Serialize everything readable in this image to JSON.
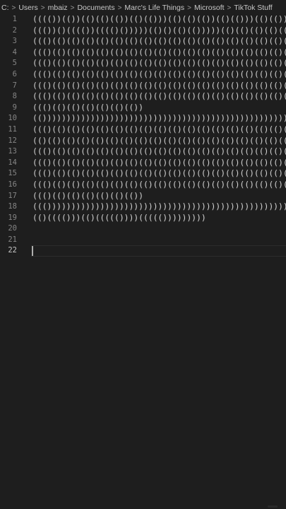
{
  "breadcrumb": [
    "C:",
    "Users",
    "mbaiz",
    "Documents",
    "Marc's Life Things",
    "Microsoft",
    "TikTok Stuff"
  ],
  "breadcrumb_separator": ">",
  "editor": {
    "active_line": 22,
    "lines": [
      {
        "number": "1",
        "text": "(((())(())(()(()(())(()(()))(()(()(())(()(()))(()(()))(((()))(()"
      },
      {
        "number": "2",
        "text": "((())()(((())(((()()))))(()()(()(()))))(()(()(()(()(()(()))(())"
      },
      {
        "number": "3",
        "text": "((()(()(()(()(()(()(()(()(()(()(()(()(()(()(()(()(()(()(()(()(()"
      },
      {
        "number": "4",
        "text": "((()(()(()(()(()(()(()(()(()(()(()(()(()(()(()(()(()(()(()(()(()"
      },
      {
        "number": "5",
        "text": "((()(()(()(()(()(()(()(()(()(()(()(()(()(()(()(()(()(()(()(()(()"
      },
      {
        "number": "6",
        "text": "((()(()(()(()(()(()(()(()(()(()(()(()(()(()(()(()(()(()(()(()(()"
      },
      {
        "number": "7",
        "text": "((()(()(()(()(()(()(()(()(()(()(()(()(()(()(()(()(()(()(()(()(()"
      },
      {
        "number": "8",
        "text": "((()(()(()(()(()(()(()(()(()(()(()(()(()(()(()(()(()(()(()(()(()"
      },
      {
        "number": "9",
        "text": "((()(()(()(()(()(()(())"
      },
      {
        "number": "10",
        "text": "(()))))))))))))))))))))))))))))))))))))))))))))))))))))))))))))))))"
      },
      {
        "number": "11",
        "text": "((()(()(()(()(()(()(()(()(()(()(()(()(()(()(()(()(()(()(()(()(()("
      },
      {
        "number": "12",
        "text": "(()(()(()(()(()(()(()(()(()(()(()(()(()(()(()(()(()(()(()(()(()(()"
      },
      {
        "number": "13",
        "text": "((()(()(()(()(()(()(()(()(()(()(()(()(()(()(()(()(()(()(()(()(()("
      },
      {
        "number": "14",
        "text": "((()(()(()(()(()(()(()(()(()(()(()(()(()(()(()(()(()(()(()(()(()("
      },
      {
        "number": "15",
        "text": "((()(()(()(()(()(()(()(()(()(()(()(()(()(()(()(()(()(()(()(()(()("
      },
      {
        "number": "16",
        "text": "((()(()(()(()(()(()(()(()(()(()(()(()(()(()(()(()(()(()(()(()(()("
      },
      {
        "number": "17",
        "text": "((()(()(()(()(()(()(())"
      },
      {
        "number": "18",
        "text": "((())))))))))))))))))))))))))))))))))))))))))))))))))))))))))))))))"
      },
      {
        "number": "19",
        "text": "(()(((()))(()((((())))((((()))))))))"
      },
      {
        "number": "20",
        "text": ""
      },
      {
        "number": "21",
        "text": ""
      },
      {
        "number": "22",
        "text": ""
      }
    ]
  }
}
